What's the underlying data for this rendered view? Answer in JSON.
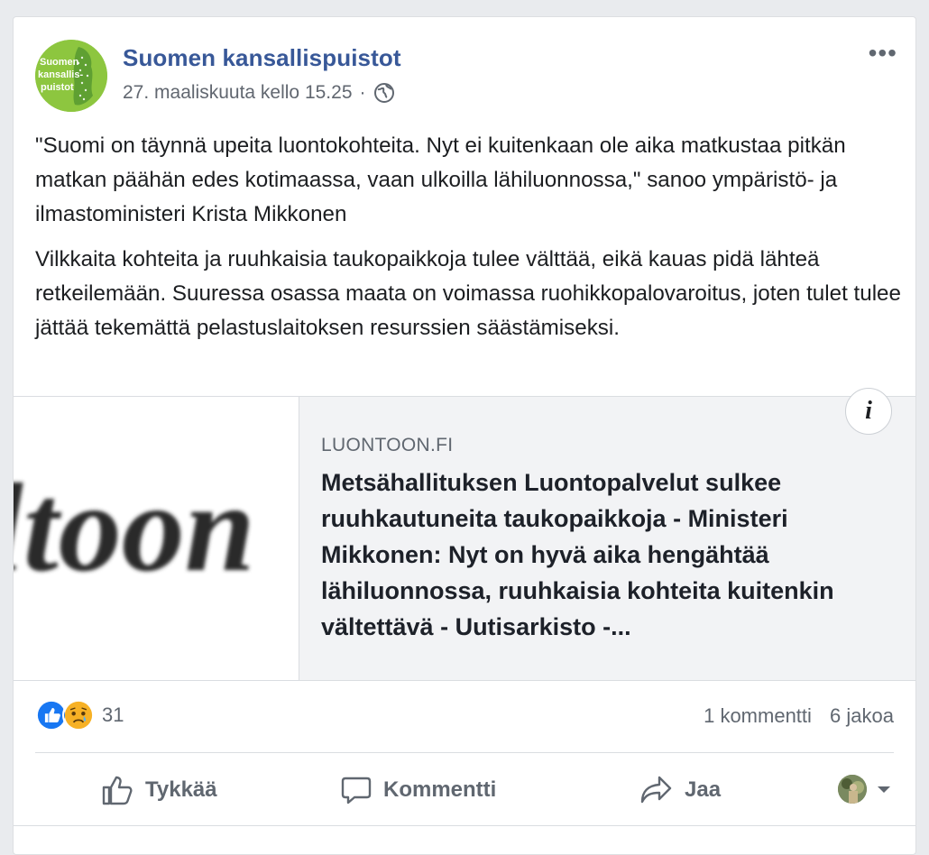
{
  "post": {
    "page_name": "Suomen kansallispuistot",
    "avatar_text": [
      "Suomen",
      "kansallis-",
      "puistot"
    ],
    "timestamp": "27. maaliskuuta kello 15.25",
    "separator": "·",
    "paragraphs": [
      "\"Suomi on täynnä upeita luontokohteita. Nyt ei kuitenkaan ole aika matkustaa pitkän matkan päähän edes kotimaassa, vaan ulkoilla lähiluonnossa,\" sanoo ympäristö- ja ilmastoministeri Krista Mikkonen",
      "Vilkkaita kohteita ja ruuhkaisia taukopaikkoja tulee välttää, eikä kauas pidä lähteä retkeilemään. Suuressa osassa maata on voimassa ruohikkopalovaroitus, joten tulet tulee jättää tekemättä pelastuslaitoksen resurssien säästämiseksi."
    ]
  },
  "link": {
    "thumb_text": "ltoon",
    "domain": "LUONTOON.FI",
    "title": "Metsähallituksen Luontopalvelut sulkee ruuhkautuneita taukopaikkoja - Ministeri Mikkonen: Nyt on hyvä aika hengähtää lähiluonnossa, ruuhkaisia kohteita kuitenkin vältettävä - Uutisarkisto -...",
    "info_label": "i"
  },
  "stats": {
    "reaction_count": "31",
    "comments": "1 kommentti",
    "shares": "6 jakoa"
  },
  "actions": {
    "like": "Tykkää",
    "comment": "Kommentti",
    "share": "Jaa"
  },
  "colors": {
    "link_blue": "#385898",
    "like_blue": "#1877f2",
    "sad_yellow": "#f7b125",
    "avatar_green": "#8dc63f"
  }
}
